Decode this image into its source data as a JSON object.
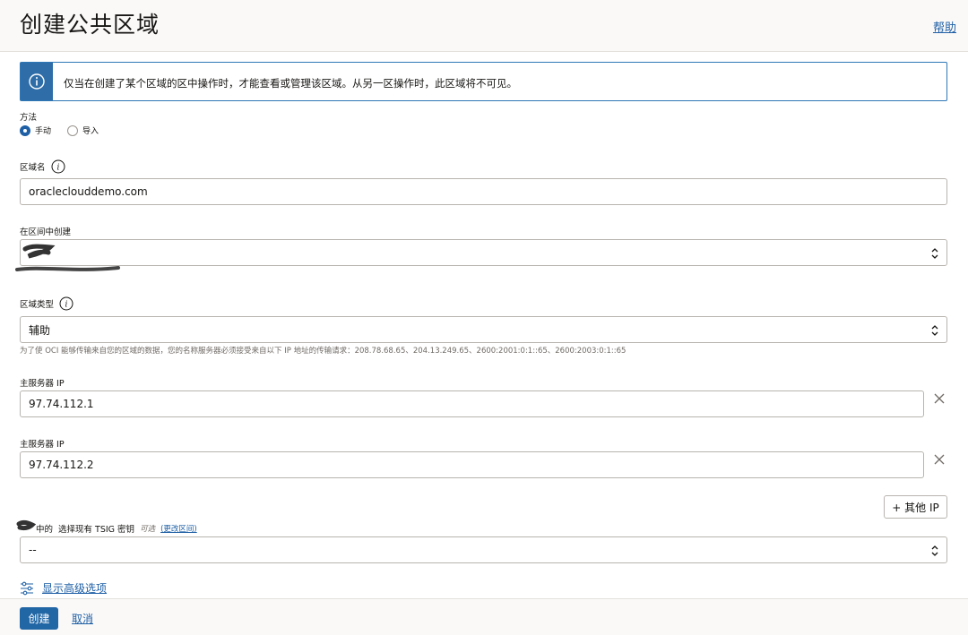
{
  "header": {
    "title": "创建公共区域",
    "help": "帮助"
  },
  "banner": {
    "icon": "info-icon",
    "message": "仅当在创建了某个区域的区中操作时，才能查看或管理该区域。从另一区操作时，此区域将不可见。"
  },
  "method": {
    "label": "方法",
    "options": [
      {
        "label": "手动",
        "checked": true
      },
      {
        "label": "导入",
        "checked": false
      }
    ]
  },
  "zone_name": {
    "label": "区域名",
    "value": "oracleclouddemo.com"
  },
  "compartment": {
    "label": "在区间中创建",
    "value": ""
  },
  "zone_type": {
    "label": "区域类型",
    "value": "辅助",
    "helper": "为了使 OCI 能够传输来自您的区域的数据，您的名称服务器必须接受来自以下 IP 地址的传输请求：208.78.68.65、204.13.249.65、2600:2001:0:1::65、2600:2003:0:1::65"
  },
  "primary_servers": [
    {
      "label": "主服务器 IP",
      "value": "97.74.112.1"
    },
    {
      "label": "主服务器 IP",
      "value": "97.74.112.2"
    }
  ],
  "add_ip_button": "+ 其他 IP",
  "tsig": {
    "label_prefix": "中的",
    "label": "选择现有 TSIG 密钥",
    "optional": "可选",
    "change_link": "(更改区间)",
    "value": "--"
  },
  "advanced": {
    "label": "显示高级选项"
  },
  "footer": {
    "create": "创建",
    "cancel": "取消"
  },
  "colors": {
    "accent": "#1e5fa5",
    "primary_button": "#2166a5",
    "banner_icon_bg": "#2e6da8"
  }
}
